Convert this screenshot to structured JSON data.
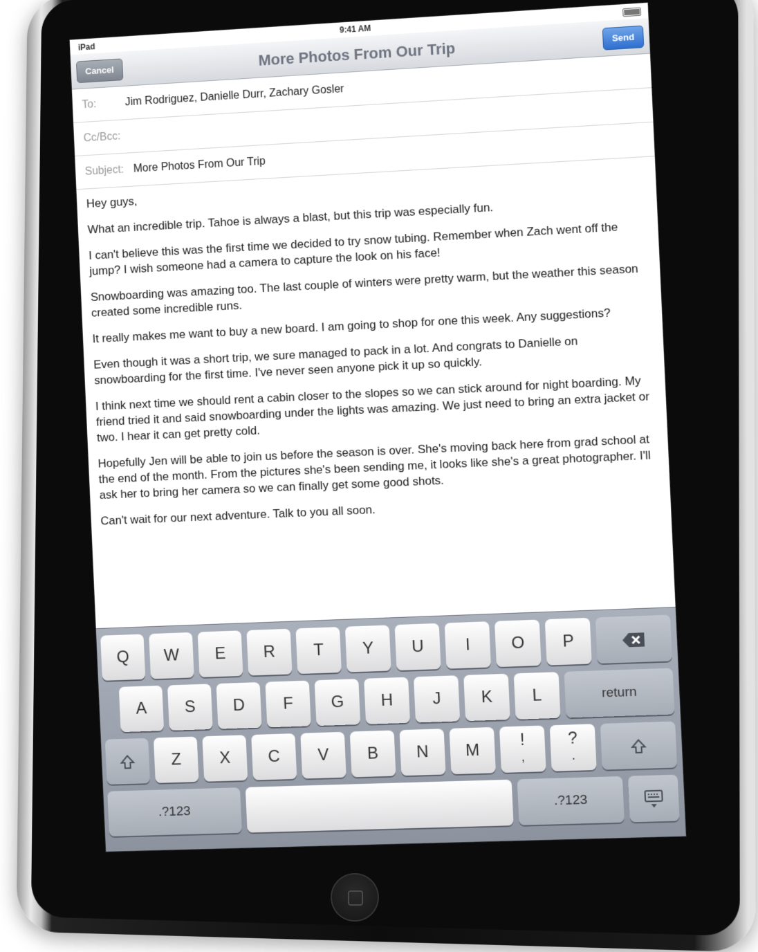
{
  "status": {
    "carrier": "iPad",
    "time": "9:41 AM"
  },
  "nav": {
    "title": "More Photos From Our Trip",
    "cancel_label": "Cancel",
    "send_label": "Send"
  },
  "fields": {
    "to_label": "To:",
    "to_value": "Jim Rodriguez, Danielle Durr, Zachary Gosler",
    "ccbcc_label": "Cc/Bcc:",
    "subject_label": "Subject:",
    "subject_value": "More Photos From Our Trip"
  },
  "body": {
    "greeting": "Hey guys,",
    "p1": "What an incredible trip. Tahoe is always a blast, but this trip was especially fun.",
    "p2": "I can't believe this was the first time we decided to try snow tubing. Remember when Zach went off the jump? I wish someone had a camera to capture the look on his face!",
    "p3": "Snowboarding was amazing too. The last couple of winters were pretty warm, but the weather this season created some incredible runs.",
    "p4": "It really makes me want to buy a new board. I am going to shop for one this week. Any suggestions?",
    "p5": "Even though it was a short trip, we sure managed to pack in a lot. And congrats to Danielle on snowboarding for the first time. I've never seen anyone pick it up so quickly.",
    "p6": "I think next time we should rent a cabin closer to the slopes so we can stick around for night boarding. My friend tried it and said snowboarding under the lights was amazing. We just need to bring an extra jacket or two. I hear it can get pretty cold.",
    "p7": "Hopefully Jen will be able to join us before the season is over. She's moving back here from grad school at the end of the month. From the pictures she's been sending me, it looks like she's a great photographer. I'll ask her to bring her camera so we can finally get some good shots.",
    "p8": "Can't wait for our next adventure. Talk to you all soon."
  },
  "keyboard": {
    "row1": [
      "Q",
      "W",
      "E",
      "R",
      "T",
      "Y",
      "U",
      "I",
      "O",
      "P"
    ],
    "row2": [
      "A",
      "S",
      "D",
      "F",
      "G",
      "H",
      "J",
      "K",
      "L"
    ],
    "row3": [
      "Z",
      "X",
      "C",
      "V",
      "B",
      "N",
      "M"
    ],
    "exclaim": "!",
    "exclaim_sub": ",",
    "question": "?",
    "question_sub": ".",
    "return_label": "return",
    "num_left": ".?123",
    "num_right": ".?123",
    "icons": {
      "backspace": "backspace-icon",
      "shift": "shift-icon",
      "hide_keyboard": "keyboard-hide-icon",
      "home": "home-button-icon"
    }
  }
}
